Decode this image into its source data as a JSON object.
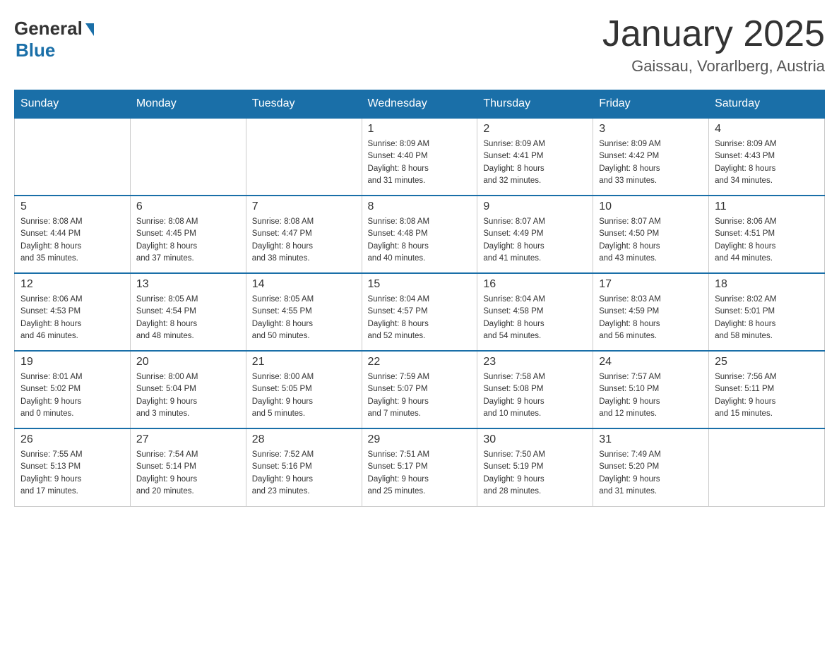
{
  "logo": {
    "general": "General",
    "blue": "Blue"
  },
  "title": "January 2025",
  "subtitle": "Gaissau, Vorarlberg, Austria",
  "days_of_week": [
    "Sunday",
    "Monday",
    "Tuesday",
    "Wednesday",
    "Thursday",
    "Friday",
    "Saturday"
  ],
  "weeks": [
    [
      {
        "day": "",
        "info": ""
      },
      {
        "day": "",
        "info": ""
      },
      {
        "day": "",
        "info": ""
      },
      {
        "day": "1",
        "info": "Sunrise: 8:09 AM\nSunset: 4:40 PM\nDaylight: 8 hours\nand 31 minutes."
      },
      {
        "day": "2",
        "info": "Sunrise: 8:09 AM\nSunset: 4:41 PM\nDaylight: 8 hours\nand 32 minutes."
      },
      {
        "day": "3",
        "info": "Sunrise: 8:09 AM\nSunset: 4:42 PM\nDaylight: 8 hours\nand 33 minutes."
      },
      {
        "day": "4",
        "info": "Sunrise: 8:09 AM\nSunset: 4:43 PM\nDaylight: 8 hours\nand 34 minutes."
      }
    ],
    [
      {
        "day": "5",
        "info": "Sunrise: 8:08 AM\nSunset: 4:44 PM\nDaylight: 8 hours\nand 35 minutes."
      },
      {
        "day": "6",
        "info": "Sunrise: 8:08 AM\nSunset: 4:45 PM\nDaylight: 8 hours\nand 37 minutes."
      },
      {
        "day": "7",
        "info": "Sunrise: 8:08 AM\nSunset: 4:47 PM\nDaylight: 8 hours\nand 38 minutes."
      },
      {
        "day": "8",
        "info": "Sunrise: 8:08 AM\nSunset: 4:48 PM\nDaylight: 8 hours\nand 40 minutes."
      },
      {
        "day": "9",
        "info": "Sunrise: 8:07 AM\nSunset: 4:49 PM\nDaylight: 8 hours\nand 41 minutes."
      },
      {
        "day": "10",
        "info": "Sunrise: 8:07 AM\nSunset: 4:50 PM\nDaylight: 8 hours\nand 43 minutes."
      },
      {
        "day": "11",
        "info": "Sunrise: 8:06 AM\nSunset: 4:51 PM\nDaylight: 8 hours\nand 44 minutes."
      }
    ],
    [
      {
        "day": "12",
        "info": "Sunrise: 8:06 AM\nSunset: 4:53 PM\nDaylight: 8 hours\nand 46 minutes."
      },
      {
        "day": "13",
        "info": "Sunrise: 8:05 AM\nSunset: 4:54 PM\nDaylight: 8 hours\nand 48 minutes."
      },
      {
        "day": "14",
        "info": "Sunrise: 8:05 AM\nSunset: 4:55 PM\nDaylight: 8 hours\nand 50 minutes."
      },
      {
        "day": "15",
        "info": "Sunrise: 8:04 AM\nSunset: 4:57 PM\nDaylight: 8 hours\nand 52 minutes."
      },
      {
        "day": "16",
        "info": "Sunrise: 8:04 AM\nSunset: 4:58 PM\nDaylight: 8 hours\nand 54 minutes."
      },
      {
        "day": "17",
        "info": "Sunrise: 8:03 AM\nSunset: 4:59 PM\nDaylight: 8 hours\nand 56 minutes."
      },
      {
        "day": "18",
        "info": "Sunrise: 8:02 AM\nSunset: 5:01 PM\nDaylight: 8 hours\nand 58 minutes."
      }
    ],
    [
      {
        "day": "19",
        "info": "Sunrise: 8:01 AM\nSunset: 5:02 PM\nDaylight: 9 hours\nand 0 minutes."
      },
      {
        "day": "20",
        "info": "Sunrise: 8:00 AM\nSunset: 5:04 PM\nDaylight: 9 hours\nand 3 minutes."
      },
      {
        "day": "21",
        "info": "Sunrise: 8:00 AM\nSunset: 5:05 PM\nDaylight: 9 hours\nand 5 minutes."
      },
      {
        "day": "22",
        "info": "Sunrise: 7:59 AM\nSunset: 5:07 PM\nDaylight: 9 hours\nand 7 minutes."
      },
      {
        "day": "23",
        "info": "Sunrise: 7:58 AM\nSunset: 5:08 PM\nDaylight: 9 hours\nand 10 minutes."
      },
      {
        "day": "24",
        "info": "Sunrise: 7:57 AM\nSunset: 5:10 PM\nDaylight: 9 hours\nand 12 minutes."
      },
      {
        "day": "25",
        "info": "Sunrise: 7:56 AM\nSunset: 5:11 PM\nDaylight: 9 hours\nand 15 minutes."
      }
    ],
    [
      {
        "day": "26",
        "info": "Sunrise: 7:55 AM\nSunset: 5:13 PM\nDaylight: 9 hours\nand 17 minutes."
      },
      {
        "day": "27",
        "info": "Sunrise: 7:54 AM\nSunset: 5:14 PM\nDaylight: 9 hours\nand 20 minutes."
      },
      {
        "day": "28",
        "info": "Sunrise: 7:52 AM\nSunset: 5:16 PM\nDaylight: 9 hours\nand 23 minutes."
      },
      {
        "day": "29",
        "info": "Sunrise: 7:51 AM\nSunset: 5:17 PM\nDaylight: 9 hours\nand 25 minutes."
      },
      {
        "day": "30",
        "info": "Sunrise: 7:50 AM\nSunset: 5:19 PM\nDaylight: 9 hours\nand 28 minutes."
      },
      {
        "day": "31",
        "info": "Sunrise: 7:49 AM\nSunset: 5:20 PM\nDaylight: 9 hours\nand 31 minutes."
      },
      {
        "day": "",
        "info": ""
      }
    ]
  ]
}
